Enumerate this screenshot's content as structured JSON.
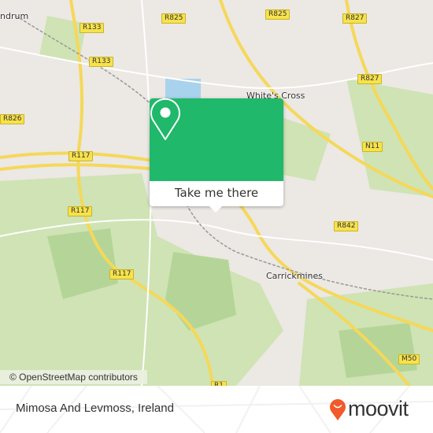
{
  "map": {
    "places": [
      "ndrum",
      "White's Cross",
      "Carrickmines"
    ],
    "road_shields": [
      "R825",
      "R825",
      "R827",
      "R133",
      "R133",
      "R826",
      "R117",
      "R117",
      "R117",
      "R827",
      "N11",
      "R842",
      "M50",
      "R1"
    ],
    "attribution": "© OpenStreetMap contributors",
    "colors": {
      "land": "#ece8e4",
      "green": "#c8e0a8",
      "road": "#f5d85a",
      "water": "#a9d3ec"
    }
  },
  "popup": {
    "button_label": "Take me there",
    "icon": "map-pin-icon",
    "color": "#20b86a"
  },
  "footer": {
    "title": "Mimosa And Levmoss, Ireland",
    "brand": "moovit",
    "brand_color": "#f15a2b"
  }
}
